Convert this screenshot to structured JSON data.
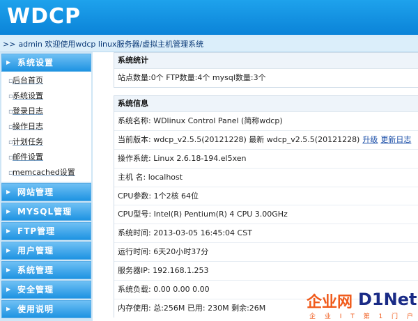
{
  "header": {
    "logo": "WDCP"
  },
  "breadcrumb": {
    "prefix": ">>",
    "text": "admin 欢迎使用wdcp linux服务器/虚拟主机管理系统"
  },
  "sidebar": {
    "sections": [
      {
        "label": "系统设置",
        "items": [
          "后台首页",
          "系统设置",
          "登录日志",
          "操作日志",
          "计划任务",
          "邮件设置",
          "memcached设置"
        ]
      },
      {
        "label": "网站管理"
      },
      {
        "label": "MYSQL管理"
      },
      {
        "label": "FTP管理"
      },
      {
        "label": "用户管理"
      },
      {
        "label": "系统管理"
      },
      {
        "label": "安全管理"
      },
      {
        "label": "使用说明"
      }
    ]
  },
  "stats": {
    "title": "系统统计",
    "line": "站点数量:0个  FTP数量:4个  mysql数量:3个"
  },
  "info": {
    "title": "系统信息",
    "rows": [
      "系统名称: WDlinux Control Panel (简称wdcp)",
      "当前版本: wdcp_v2.5.5(20121228) 最新 wdcp_v2.5.5(20121228)",
      "操作系统: Linux 2.6.18-194.el5xen",
      "主机 名: localhost",
      "CPU参数: 1个2核 64位",
      "CPU型号:  Intel(R) Pentium(R) 4 CPU 3.00GHz",
      "系统时间: 2013-03-05 16:45:04 CST",
      "运行时间: 6天20小时37分",
      "服务器IP: 192.168.1.253",
      "系统负载: 0.00   0.00   0.00",
      "内存使用: 总:256M   已用: 230M   剩余:26M"
    ],
    "upgrade_link": "升级",
    "changelog_link": "更新日志"
  },
  "watermark": {
    "cn": "企业网",
    "en": "D1Net",
    "tag": "企 业 I T 第 1 门 户"
  }
}
